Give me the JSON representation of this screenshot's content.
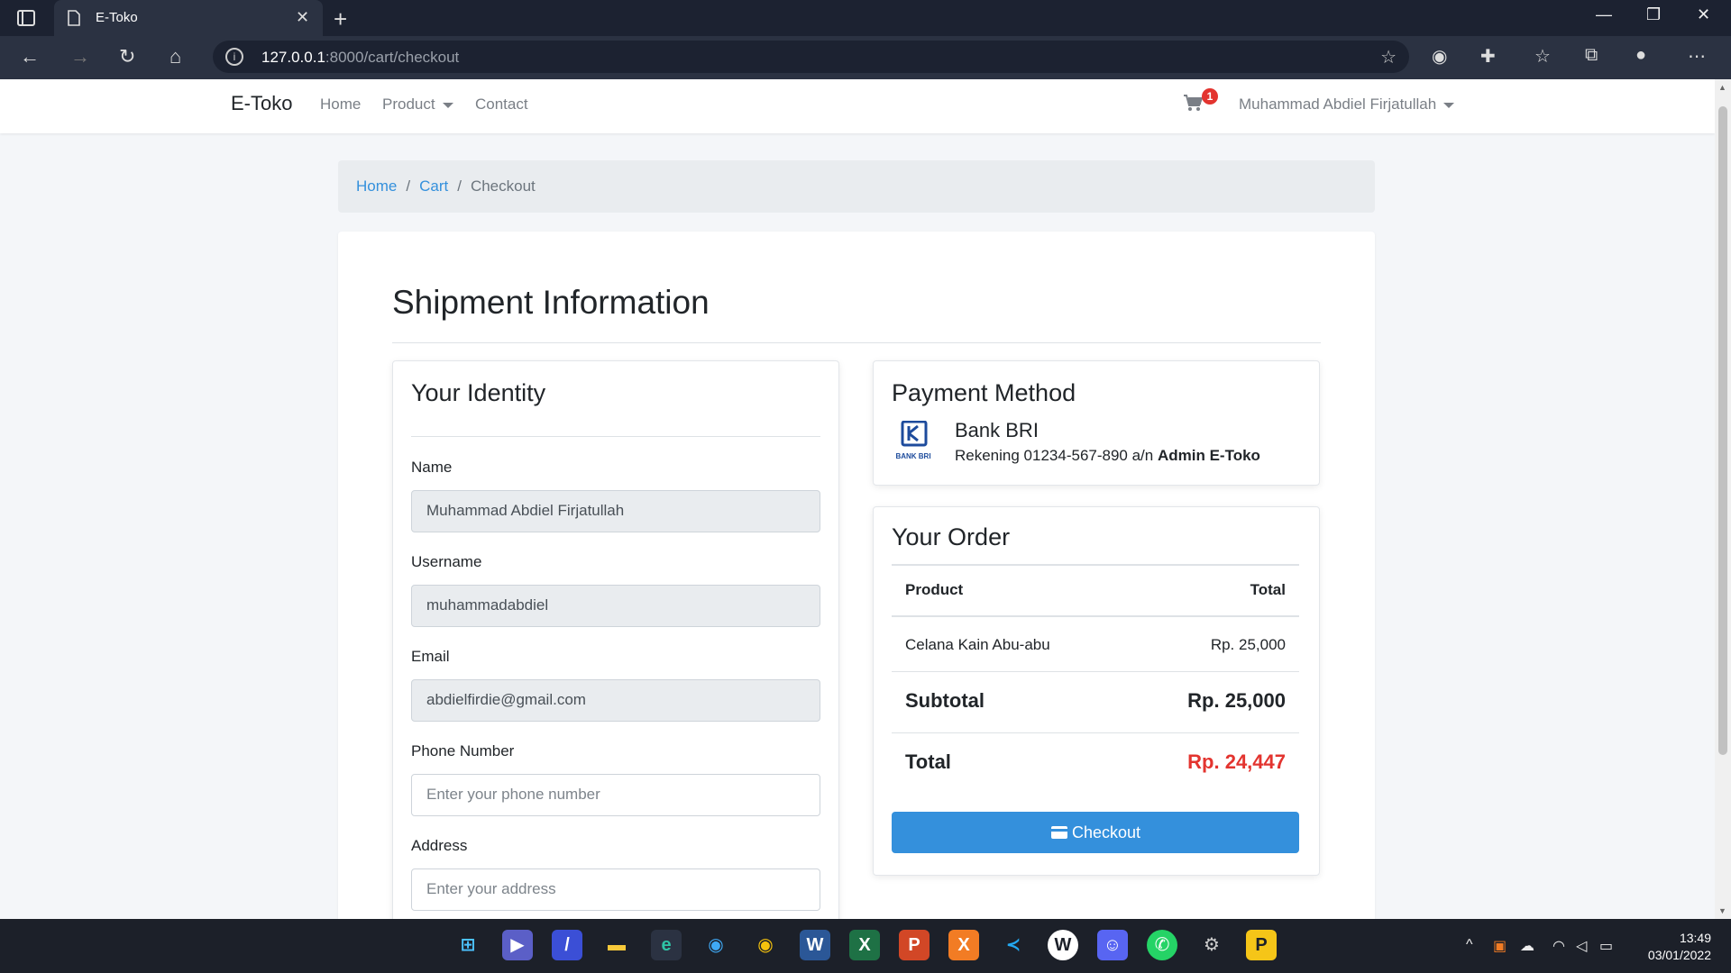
{
  "browser": {
    "tab_title": "E-Toko",
    "url_host": "127.0.0.1",
    "url_path": ":8000/cart/checkout"
  },
  "navbar": {
    "brand": "E-Toko",
    "links": [
      "Home",
      "Product",
      "Contact"
    ],
    "cart_count": "1",
    "user_name": "Muhammad Abdiel Firjatullah"
  },
  "breadcrumb": {
    "home": "Home",
    "cart": "Cart",
    "current": "Checkout"
  },
  "shipment": {
    "title": "Shipment Information"
  },
  "identity": {
    "title": "Your Identity",
    "name_label": "Name",
    "name_value": "Muhammad Abdiel Firjatullah",
    "username_label": "Username",
    "username_value": "muhammadabdiel",
    "email_label": "Email",
    "email_value": "abdielfirdie@gmail.com",
    "phone_label": "Phone Number",
    "phone_placeholder": "Enter your phone number",
    "address_label": "Address",
    "address_placeholder": "Enter your address"
  },
  "payment": {
    "title": "Payment Method",
    "bank_logo_text": "BANK BRI",
    "bank_name": "Bank BRI",
    "account_text": "Rekening 01234-567-890 a/n",
    "account_holder": "Admin E-Toko"
  },
  "order": {
    "title": "Your Order",
    "col_product": "Product",
    "col_total": "Total",
    "item_name": "Celana Kain Abu-abu",
    "item_price": "Rp. 25,000",
    "subtotal_label": "Subtotal",
    "subtotal_value": "Rp. 25,000",
    "total_label": "Total",
    "total_value": "Rp. 24,447",
    "checkout_label": "Checkout"
  },
  "taskbar": {
    "time": "13:49",
    "date": "03/01/2022"
  },
  "colors": {
    "primary": "#3490dc",
    "danger": "#e3342f"
  }
}
